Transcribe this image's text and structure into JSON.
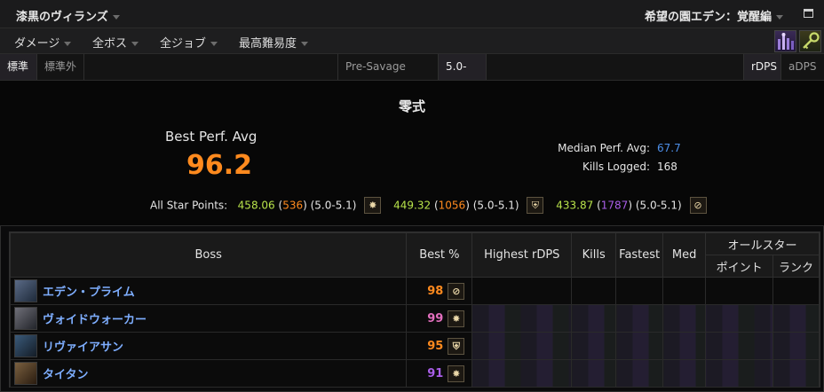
{
  "titlebar": {
    "character_name": "漆黒のヴィランズ",
    "zone_selector": "希望の園エデン：覚醒編"
  },
  "filters": [
    "ダメージ",
    "全ボス",
    "全ジョブ",
    "最高難易度"
  ],
  "tabs": {
    "standard": "標準",
    "non_standard": "標準外",
    "presavage": "Pre-Savage (5.0)",
    "patch": "5.0-5.1",
    "rdps": "rDPS",
    "adps": "aDPS"
  },
  "summary": {
    "zone_title": "零式",
    "best_perf_label": "Best Perf. Avg",
    "best_perf_value": "96.2",
    "median_label": "Median Perf. Avg:",
    "median_value": "67.7",
    "kills_label": "Kills Logged:",
    "kills_value": "168",
    "all_star_label": "All Star Points:",
    "all_star": [
      {
        "points": "458.06",
        "rank": "536",
        "patch": "(5.0-5.1)",
        "job_icon": "astrologian-icon",
        "glyph": "✸"
      },
      {
        "points": "449.32",
        "rank": "1056",
        "patch": "(5.0-5.1)",
        "job_icon": "paladin-icon",
        "glyph": "⛨"
      },
      {
        "points": "433.87",
        "rank": "1787",
        "patch": "(5.0-5.1)",
        "job_icon": "scholar-icon",
        "glyph": "⊘"
      }
    ]
  },
  "table": {
    "headers": {
      "boss": "Boss",
      "best": "Best %",
      "highest": "Highest rDPS",
      "kills": "Kills",
      "fastest": "Fastest",
      "med": "Med",
      "allstar": "オールスター",
      "points": "ポイント",
      "rank": "ランク"
    },
    "rows": [
      {
        "name": "エデン・プライム",
        "best": "98",
        "best_color": "#ff8a1e",
        "job_icon": "scholar-icon",
        "glyph": "⊘"
      },
      {
        "name": "ヴォイドウォーカー",
        "best": "99",
        "best_color": "#e26fbd",
        "job_icon": "astrologian-icon",
        "glyph": "✸"
      },
      {
        "name": "リヴァイアサン",
        "best": "95",
        "best_color": "#ff8a1e",
        "job_icon": "paladin-icon",
        "glyph": "⛨"
      },
      {
        "name": "タイタン",
        "best": "91",
        "best_color": "#a95ee8",
        "job_icon": "astrologian-icon",
        "glyph": "✸"
      }
    ]
  },
  "colors": {
    "legendary_orange": "#ff8a1e",
    "epic_purple": "#a95ee8",
    "pink": "#e26fbd",
    "green": "#b7e24a",
    "blue": "#4d8fe8",
    "boss_name": "#7eaeff"
  }
}
